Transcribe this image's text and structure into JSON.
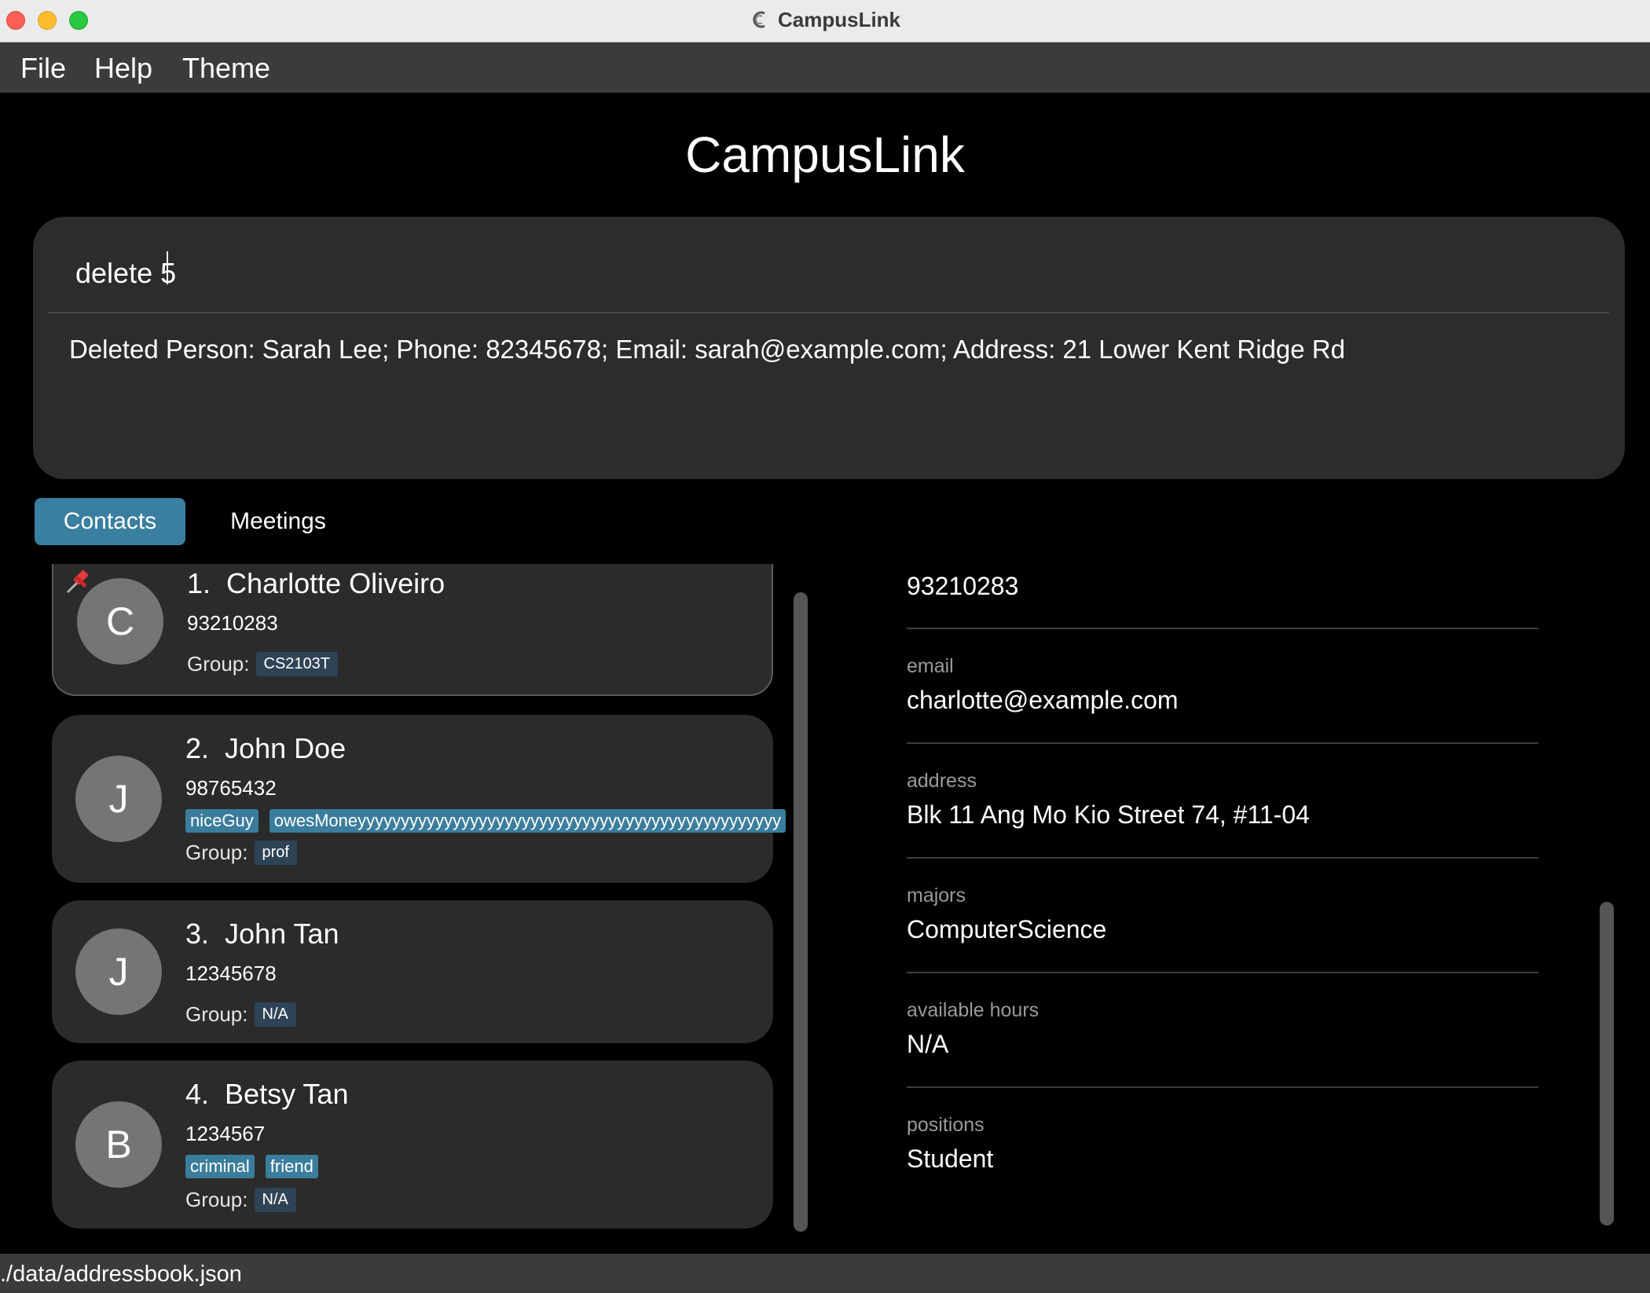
{
  "window": {
    "title": "CampusLink"
  },
  "menu": {
    "file": "File",
    "help": "Help",
    "theme": "Theme"
  },
  "header": {
    "title": "CampusLink"
  },
  "command": {
    "input_value": "delete 5",
    "result": "Deleted Person: Sarah Lee; Phone: 82345678; Email: sarah@example.com; Address: 21 Lower Kent Ridge Rd"
  },
  "tabs": {
    "contacts": "Contacts",
    "meetings": "Meetings"
  },
  "group_label": "Group:",
  "contacts": [
    {
      "index": "1.",
      "name": "Charlotte Oliveiro",
      "initial": "C",
      "phone": "93210283",
      "tags": [],
      "group": "CS2103T",
      "pinned": true
    },
    {
      "index": "2.",
      "name": "John Doe",
      "initial": "J",
      "phone": "98765432",
      "tags": [
        "niceGuy",
        "owesMoneyyyyyyyyyyyyyyyyyyyyyyyyyyyyyyyyyyyyyyyyyyyyyyyyy"
      ],
      "group": "prof"
    },
    {
      "index": "3.",
      "name": "John Tan",
      "initial": "J",
      "phone": "12345678",
      "tags": [],
      "group": "N/A"
    },
    {
      "index": "4.",
      "name": "Betsy Tan",
      "initial": "B",
      "phone": "1234567",
      "tags": [
        "criminal",
        "friend"
      ],
      "group": "N/A"
    }
  ],
  "details": {
    "phone": "93210283",
    "email_label": "email",
    "email": "charlotte@example.com",
    "address_label": "address",
    "address": "Blk 11 Ang Mo Kio Street 74, #11-04",
    "majors_label": "majors",
    "majors": "ComputerScience",
    "hours_label": "available hours",
    "hours": "N/A",
    "positions_label": "positions",
    "positions": "Student"
  },
  "status": {
    "path": "./data/addressbook.json"
  },
  "colors": {
    "accent": "#3a7ea0",
    "tag": "#3b7d9c",
    "group_chip": "#2f4356",
    "panel": "#2c2c2c"
  }
}
